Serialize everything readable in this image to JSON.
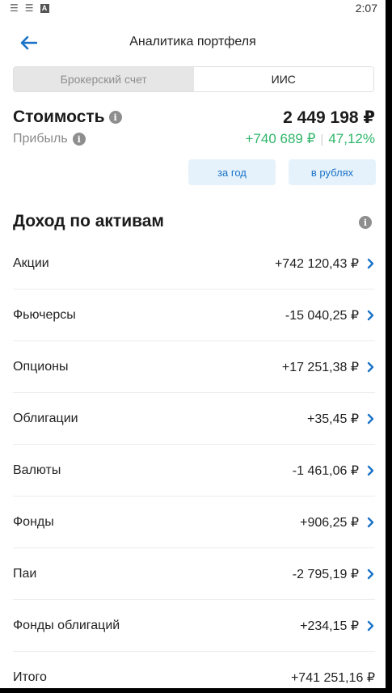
{
  "status_bar": {
    "time": "2:07",
    "icons": [
      "notification-lines-icon",
      "notification-lines-icon",
      "app-a-icon"
    ]
  },
  "app_bar": {
    "title": "Аналитика портфеля",
    "back_icon": "arrow-left-icon"
  },
  "account_tabs": [
    {
      "label": "Брокерский счет",
      "selected": false
    },
    {
      "label": "ИИС",
      "selected": true
    }
  ],
  "summary": {
    "value_label": "Стоимость",
    "value_amount": "2 449 198 ₽",
    "profit_label": "Прибыль",
    "profit_amount": "+740 689 ₽",
    "profit_percent": "47,12%"
  },
  "filters": {
    "period": "за год",
    "currency": "в рублях"
  },
  "income_section": {
    "title": "Доход по активам",
    "rows": [
      {
        "name": "Акции",
        "value": "+742 120,43 ₽"
      },
      {
        "name": "Фьючерсы",
        "value": "-15 040,25 ₽"
      },
      {
        "name": "Опционы",
        "value": "+17 251,38 ₽"
      },
      {
        "name": "Облигации",
        "value": "+35,45 ₽"
      },
      {
        "name": "Валюты",
        "value": "-1 461,06 ₽"
      },
      {
        "name": "Фонды",
        "value": "+906,25 ₽"
      },
      {
        "name": "Паи",
        "value": "-2 795,19 ₽"
      },
      {
        "name": "Фонды облигаций",
        "value": "+234,15 ₽"
      }
    ],
    "total_label": "Итого",
    "total_value": "+741 251,16 ₽"
  },
  "colors": {
    "accent": "#1a73c8",
    "profit_green": "#2fb56a",
    "chip_bg": "#e6f2fb",
    "muted": "#8a8a8a"
  }
}
